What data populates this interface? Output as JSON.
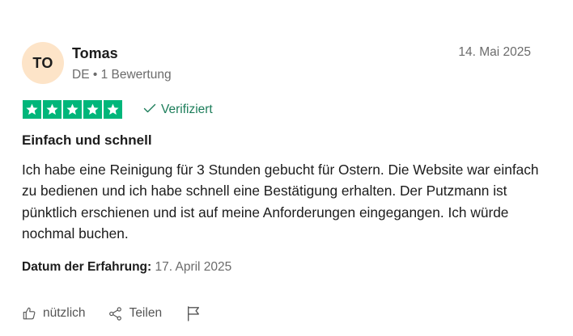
{
  "reviewer": {
    "initials": "TO",
    "name": "Tomas",
    "meta": "DE • 1 Bewertung",
    "avatar_color": "#fde4c8"
  },
  "review": {
    "date": "14. Mai 2025",
    "rating": 5,
    "max_rating": 5,
    "star_color": "#00b67a",
    "verified_label": "Verifiziert",
    "title": "Einfach und schnell",
    "body": "Ich habe eine Reinigung für 3 Stunden gebucht für Ostern. Die Website war einfach zu bedienen und ich habe schnell eine Bestätigung erhalten. Der Putzmann ist pünktlich erschienen und ist auf meine Anforderungen eingegangen. Ich würde nochmal buchen.",
    "experience_label": "Datum der Erfahrung:",
    "experience_date": "17. April 2025"
  },
  "actions": {
    "useful_label": "nützlich",
    "share_label": "Teilen",
    "useful_icon": "thumbs-up-icon",
    "share_icon": "share-icon",
    "report_icon": "flag-icon"
  }
}
